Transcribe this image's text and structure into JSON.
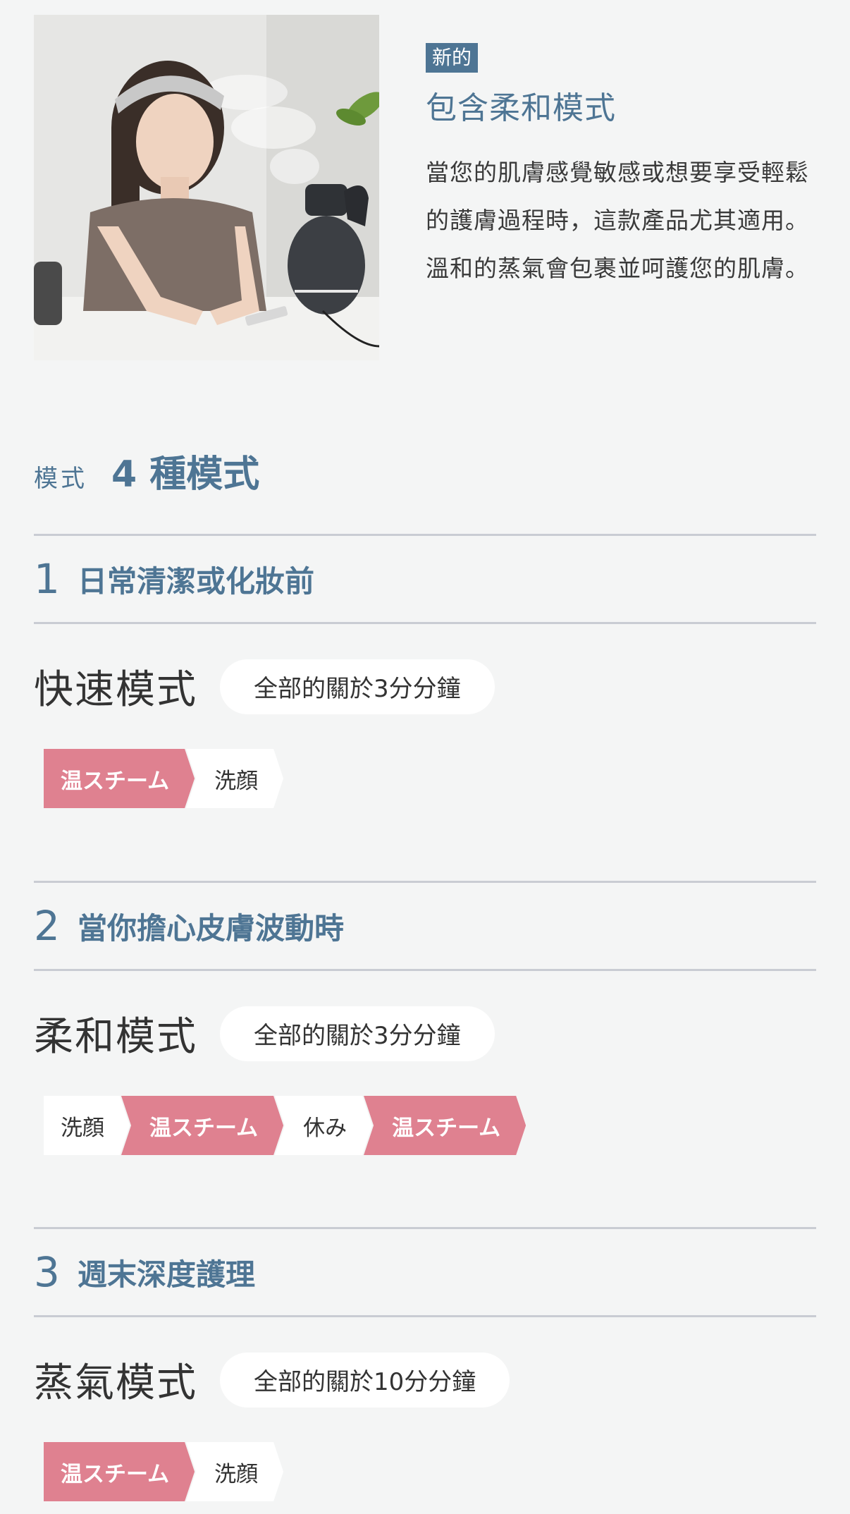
{
  "intro": {
    "badge": "新的",
    "title": "包含柔和模式",
    "description": "當您的肌膚感覺敏感或想要享受輕鬆的護膚過程時，這款產品尤其適用。溫和的蒸氣會包裹並呵護您的肌膚。"
  },
  "modes": {
    "label": "模式",
    "title": "4 種模式"
  },
  "sections": [
    {
      "number": "1",
      "title": "日常清潔或化妝前",
      "mode_name": "快速模式",
      "duration": "全部的關於3分分鐘",
      "steps": [
        {
          "label": "温スチーム",
          "style": "pink"
        },
        {
          "label": "洗顔",
          "style": "white"
        }
      ]
    },
    {
      "number": "2",
      "title": "當你擔心皮膚波動時",
      "mode_name": "柔和模式",
      "duration": "全部的關於3分分鐘",
      "steps": [
        {
          "label": "洗顔",
          "style": "white"
        },
        {
          "label": "温スチーム",
          "style": "pink"
        },
        {
          "label": "休み",
          "style": "white"
        },
        {
          "label": "温スチーム",
          "style": "pink"
        }
      ]
    },
    {
      "number": "3",
      "title": "週末深度護理",
      "mode_name": "蒸氣模式",
      "duration": "全部的關於10分分鐘",
      "steps": [
        {
          "label": "温スチーム",
          "style": "pink"
        },
        {
          "label": "洗顔",
          "style": "white"
        }
      ]
    }
  ],
  "colors": {
    "accent_blue": "#4e7594",
    "step_pink": "#df8190",
    "background": "#f4f5f5",
    "divider": "#c9ccd3"
  }
}
